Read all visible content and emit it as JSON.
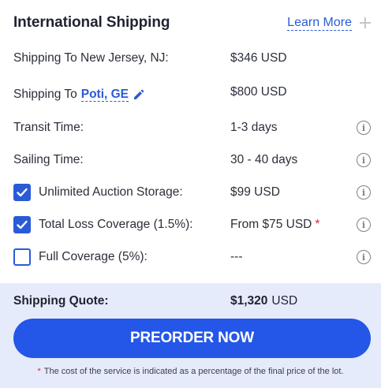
{
  "header": {
    "title": "International Shipping",
    "learn_more": "Learn More"
  },
  "rows": [
    {
      "label": "Shipping To New Jersey, NJ:",
      "value": "$346 USD"
    },
    {
      "label_prefix": "Shipping To",
      "destination": "Poti, GE",
      "value": "$800 USD"
    },
    {
      "label": "Transit Time:",
      "value": "1-3 days"
    },
    {
      "label": "Sailing Time:",
      "value": "30 - 40 days"
    },
    {
      "label": "Unlimited Auction Storage:",
      "value": "$99 USD",
      "checked": true
    },
    {
      "label": "Total Loss Coverage (1.5%):",
      "value": "From $75 USD",
      "asterisk": "*",
      "checked": true
    },
    {
      "label": "Full Coverage (5%):",
      "value": "---",
      "checked": false
    }
  ],
  "quote": {
    "label": "Shipping Quote:",
    "amount": "$1,320",
    "currency": "USD"
  },
  "button": {
    "label": "PREORDER NOW"
  },
  "footnote": {
    "star": "*",
    "text": "The cost of the service is indicated as a percentage of the final price of the lot."
  },
  "colors": {
    "accent": "#2456e8",
    "link": "#2a5bd7",
    "panel": "#e6ebfb",
    "asterisk": "#e0263a"
  },
  "icons": [
    "plus-icon",
    "pencil-icon",
    "info-icon",
    "checkbox-check-icon"
  ]
}
